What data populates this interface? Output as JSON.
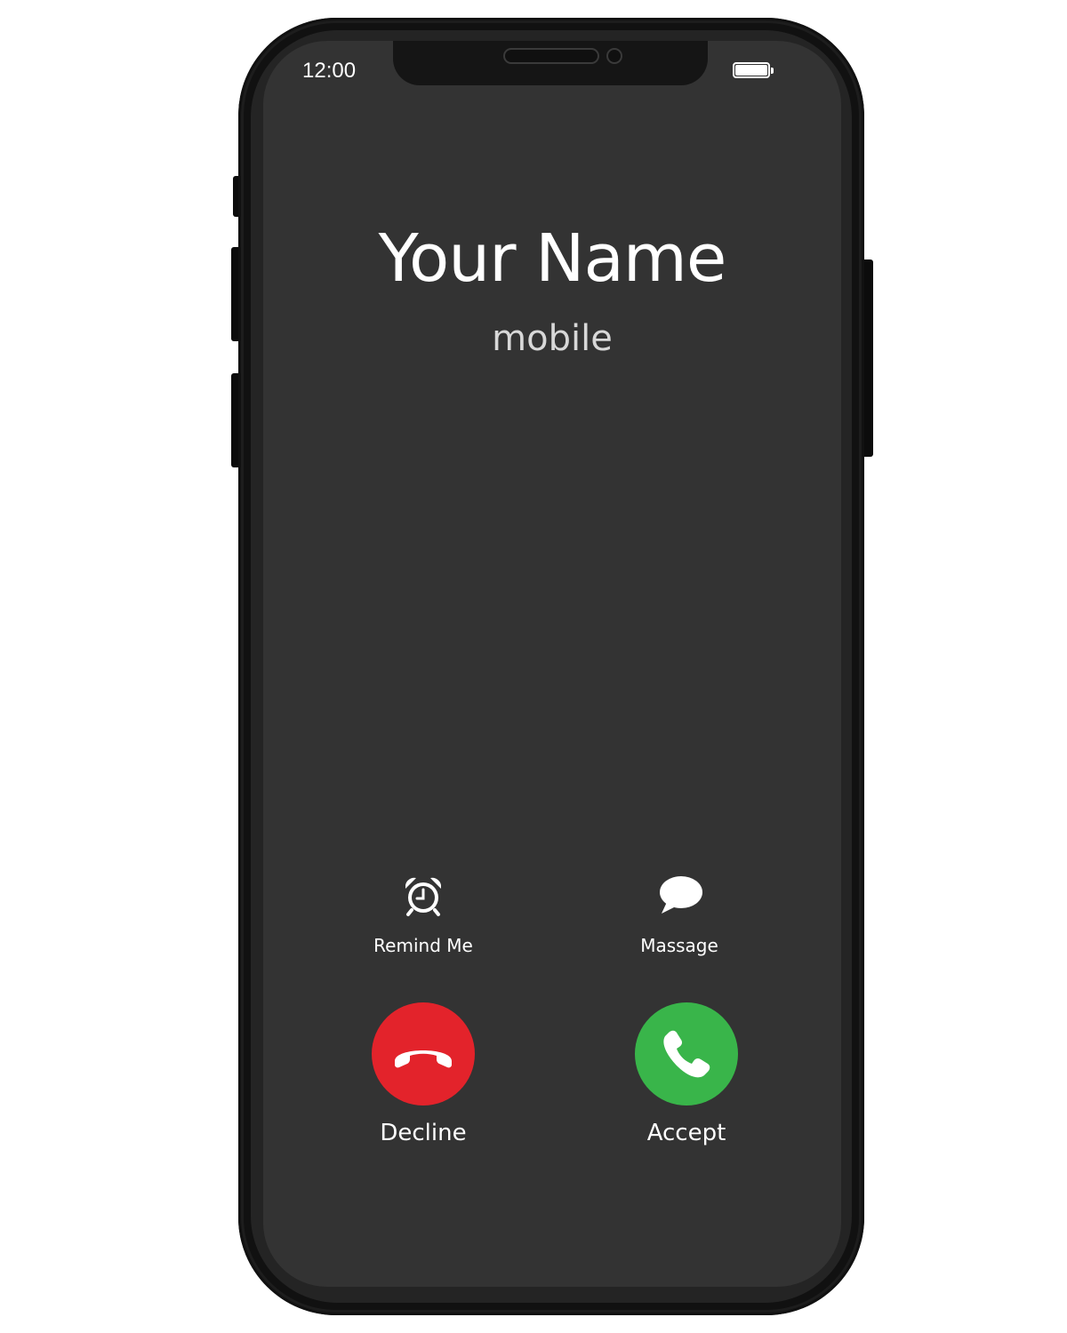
{
  "status_bar": {
    "time": "12:00",
    "battery_icon": "battery-full-icon"
  },
  "caller": {
    "name": "Your Name",
    "label": "mobile"
  },
  "actions": {
    "remind": {
      "label": "Remind Me",
      "icon": "alarm-clock-icon"
    },
    "message": {
      "label": "Massage",
      "icon": "speech-bubble-icon"
    }
  },
  "call_buttons": {
    "decline": {
      "label": "Decline",
      "icon": "hang-up-phone-icon",
      "color": "#e3232b"
    },
    "accept": {
      "label": "Accept",
      "icon": "phone-handset-icon",
      "color": "#39b54a"
    }
  },
  "colors": {
    "screen_background": "#333333",
    "bezel": "#1d1d1d",
    "text": "#ffffff"
  }
}
